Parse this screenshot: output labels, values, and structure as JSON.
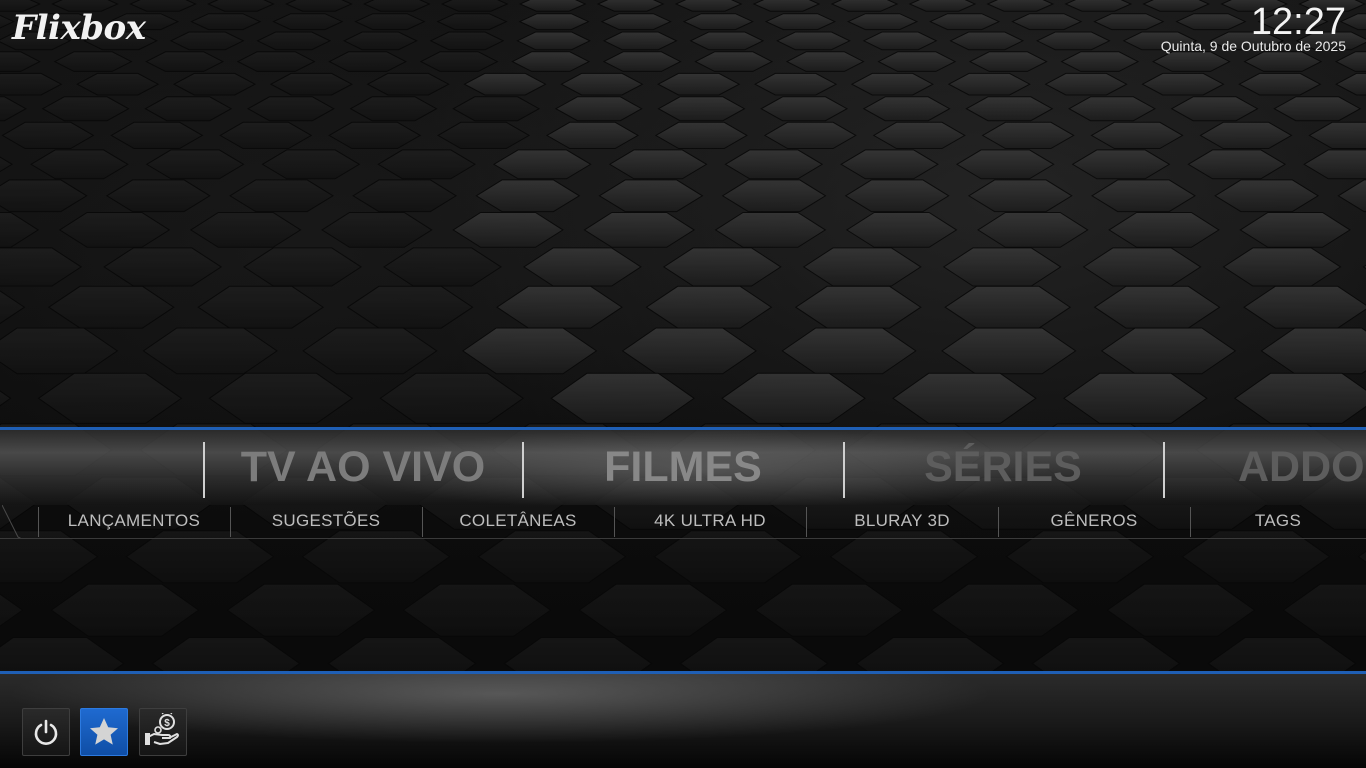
{
  "header": {
    "logo": "Flixbox",
    "time": "12:27",
    "date": "Quinta, 9 de Outubro de 2025"
  },
  "main_menu": {
    "items": [
      {
        "label": "TV AO VIVO"
      },
      {
        "label": "FILMES"
      },
      {
        "label": "SÉRIES"
      },
      {
        "label": "ADDONS"
      }
    ],
    "selected": "FILMES"
  },
  "sub_menu": {
    "items": [
      {
        "label": "LANÇAMENTOS"
      },
      {
        "label": "SUGESTÕES"
      },
      {
        "label": "COLETÂNEAS"
      },
      {
        "label": "4K ULTRA HD"
      },
      {
        "label": "BLURAY 3D"
      },
      {
        "label": "GÊNEROS"
      },
      {
        "label": "TAGS"
      }
    ]
  },
  "bottom_buttons": [
    {
      "icon": "power-icon"
    },
    {
      "icon": "star-icon",
      "active": true
    },
    {
      "icon": "donate-icon"
    }
  ],
  "colors": {
    "accent": "#1f5fb5",
    "active_button": "#1a62c4"
  }
}
